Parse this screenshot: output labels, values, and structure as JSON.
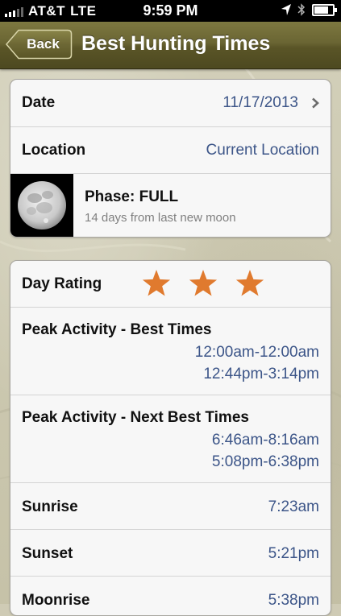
{
  "status_bar": {
    "carrier": "AT&T",
    "network": "LTE",
    "time": "9:59 PM",
    "battery_level": 0.85,
    "icons": [
      "signal-bars-icon",
      "location-arrow-icon",
      "bluetooth-icon",
      "battery-icon"
    ]
  },
  "nav": {
    "back_label": "Back",
    "title": "Best Hunting Times",
    "color": "#6a6533"
  },
  "info": {
    "date_label": "Date",
    "date_value": "11/17/2013",
    "location_label": "Location",
    "location_value": "Current Location",
    "phase_title": "Phase: FULL",
    "phase_subtitle": "14 days from last new moon",
    "moon_image": "full-moon-image"
  },
  "details": {
    "day_rating_label": "Day Rating",
    "day_rating_stars": 3,
    "star_color": "#e07a2e",
    "best_label": "Peak Activity - Best Times",
    "best_times": [
      "12:00am-12:00am",
      "12:44pm-3:14pm"
    ],
    "next_best_label": "Peak Activity - Next Best Times",
    "next_best_times": [
      "6:46am-8:16am",
      "5:08pm-6:38pm"
    ],
    "sunrise_label": "Sunrise",
    "sunrise_value": "7:23am",
    "sunset_label": "Sunset",
    "sunset_value": "5:21pm",
    "moonrise_label": "Moonrise",
    "moonrise_value": "5:38pm"
  },
  "colors": {
    "value_text": "#3c5588",
    "label_text": "#111111"
  }
}
